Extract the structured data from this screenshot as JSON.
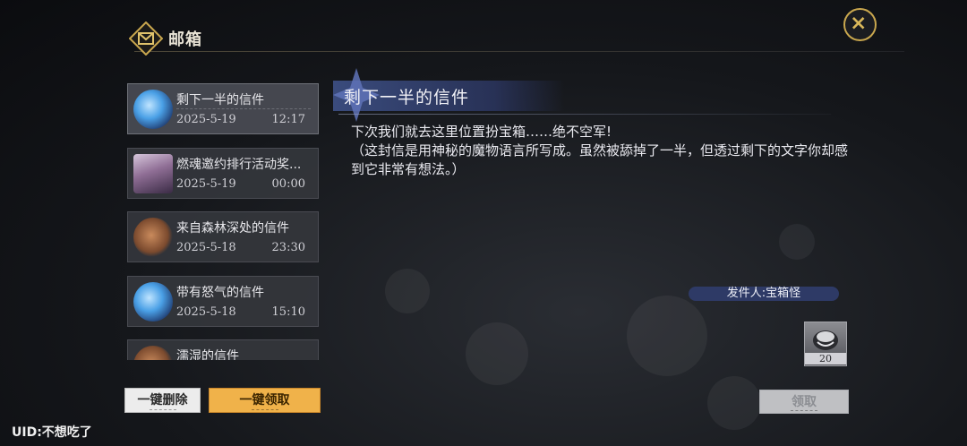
{
  "header": {
    "title": "邮箱",
    "close_icon": "close-icon"
  },
  "mails": [
    {
      "subject": "剩下一半的信件",
      "date": "2025-5-19",
      "time": "12:17",
      "thumb": "blue-orb",
      "selected": true
    },
    {
      "subject": "燃魂邀约排行活动奖...",
      "date": "2025-5-19",
      "time": "00:00",
      "thumb": "portrait",
      "selected": false
    },
    {
      "subject": "来自森林深处的信件",
      "date": "2025-5-18",
      "time": "23:30",
      "thumb": "amber-orb",
      "selected": false
    },
    {
      "subject": "带有怒气的信件",
      "date": "2025-5-18",
      "time": "15:10",
      "thumb": "blue-orb",
      "selected": false
    },
    {
      "subject": "濡湿的信件",
      "date": "",
      "time": "",
      "thumb": "amber-orb",
      "selected": false
    }
  ],
  "buttons": {
    "delete_all": "一键删除",
    "claim_all": "一键领取",
    "claim": "领取"
  },
  "detail": {
    "title": "剩下一半的信件",
    "body_line1": "下次我们就去这里位置扮宝箱……绝不空军!",
    "body_line2": "（这封信是用神秘的魔物语言所写成。虽然被舔掉了一半，但透过剩下的文字你却感到它非常有想法。）",
    "sender": "发件人:宝箱怪",
    "attachment_qty": "20",
    "attachment_icon": "treasure-item-icon"
  },
  "uid": "UID:不想吃了",
  "colors": {
    "accent_gold": "#c9a74e",
    "claim_all_bg": "#f0b24a",
    "sender_badge": "#2e3a66",
    "banner_blue": "#3c4e82"
  }
}
